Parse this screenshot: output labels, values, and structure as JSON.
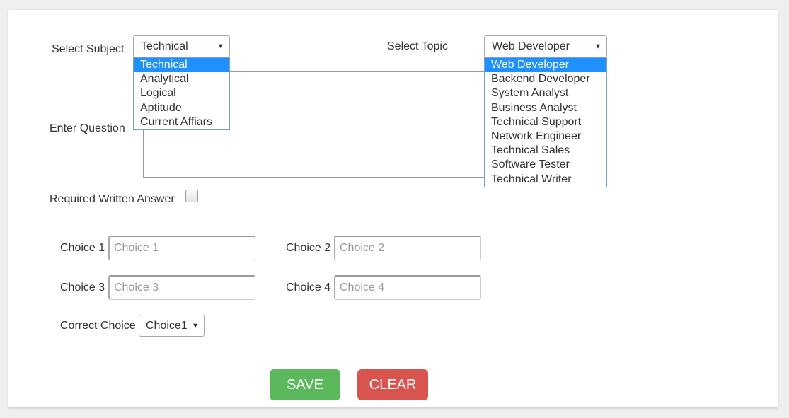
{
  "subject": {
    "label": "Select Subject",
    "selected": "Technical",
    "options": [
      "Technical",
      "Analytical",
      "Logical",
      "Aptitude",
      "Current Affiars"
    ]
  },
  "topic": {
    "label": "Select Topic",
    "selected": "Web Developer",
    "options": [
      "Web Developer",
      "Backend Developer",
      "System Analyst",
      "Business Analyst",
      "Technical Support",
      "Network Engineer",
      "Technical Sales",
      "Software Tester",
      "Technical Writer"
    ]
  },
  "question": {
    "label": "Enter Question"
  },
  "written_answer": {
    "label": "Required Written Answer"
  },
  "choices": [
    {
      "label": "Choice 1",
      "placeholder": "Choice 1"
    },
    {
      "label": "Choice 2",
      "placeholder": "Choice 2"
    },
    {
      "label": "Choice 3",
      "placeholder": "Choice 3"
    },
    {
      "label": "Choice 4",
      "placeholder": "Choice 4"
    }
  ],
  "correct_choice": {
    "label": "Correct Choice",
    "selected": "Choice1"
  },
  "buttons": {
    "save": "SAVE",
    "clear": "CLEAR"
  },
  "colors": {
    "save": "#5cb85c",
    "clear": "#d9534f",
    "option_highlight": "#1e90ff"
  }
}
